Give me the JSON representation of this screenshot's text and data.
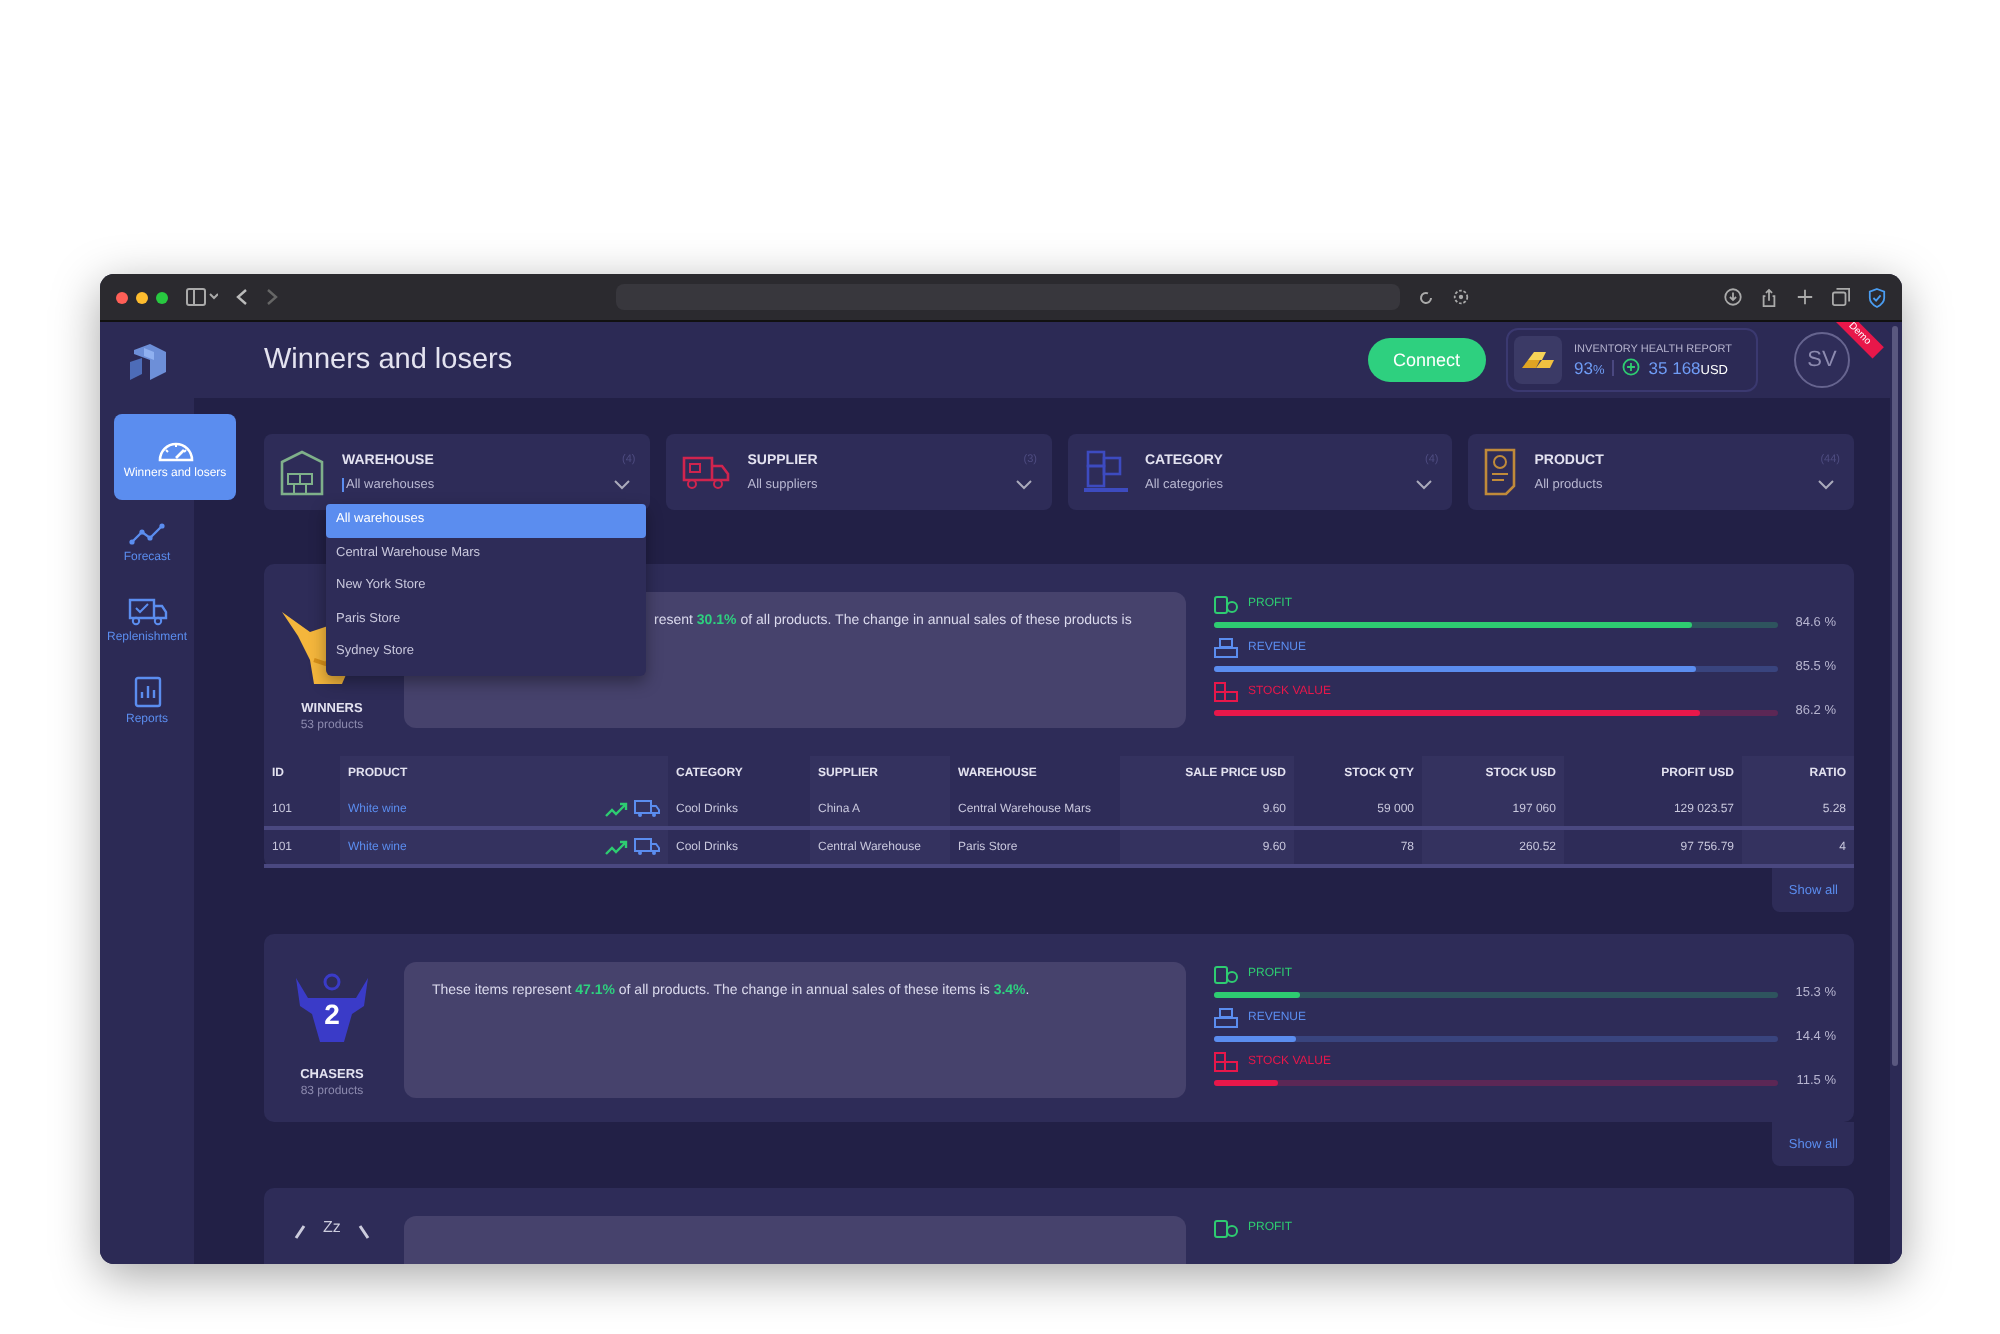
{
  "sidebar": {
    "items": [
      {
        "label": "Winners and losers",
        "selected": true
      },
      {
        "label": "Forecast",
        "selected": false
      },
      {
        "label": "Replenishment",
        "selected": false
      },
      {
        "label": "Reports",
        "selected": false
      }
    ]
  },
  "header": {
    "title": "Winners and losers",
    "connect_button": "Connect",
    "inventory": {
      "title": "INVENTORY HEALTH REPORT",
      "percent": "93",
      "percent_unit": "%",
      "amount": "35 168",
      "currency": "USD"
    },
    "avatar": {
      "initials": "SV",
      "ribbon": "Demo"
    }
  },
  "filters": [
    {
      "label": "WAREHOUSE",
      "count": "(4)",
      "value": "All warehouses",
      "open": true,
      "options": [
        {
          "label": "All warehouses",
          "selected": true
        },
        {
          "label": "Central Warehouse Mars",
          "selected": false
        },
        {
          "label": "New York Store",
          "selected": false
        },
        {
          "label": "Paris Store",
          "selected": false
        },
        {
          "label": "Sydney Store",
          "selected": false
        }
      ]
    },
    {
      "label": "SUPPLIER",
      "count": "(3)",
      "value": "All suppliers",
      "open": false
    },
    {
      "label": "CATEGORY",
      "count": "(4)",
      "value": "All categories",
      "open": false
    },
    {
      "label": "PRODUCT",
      "count": "(44)",
      "value": "All products",
      "open": false
    }
  ],
  "sections": [
    {
      "kind": "winner",
      "title": "WINNERS",
      "subtitle": "53 products",
      "summary": "resent **30.1%** of all products. The change in annual sales of these products is",
      "metrics": [
        {
          "label": "PROFIT",
          "color": "#2ecc71",
          "level": 0.846,
          "reading": "84.6 %"
        },
        {
          "label": "REVENUE",
          "color": "#5b8def",
          "level": 0.855,
          "reading": "85.5 %"
        },
        {
          "label": "STOCK VALUE",
          "color": "#e8174a",
          "level": 0.862,
          "reading": "86.2 %"
        }
      ],
      "table": {
        "columns": [
          "ID",
          "PRODUCT",
          "CATEGORY",
          "SUPPLIER",
          "WAREHOUSE",
          "SALE PRICE USD",
          "STOCK QTY",
          "STOCK USD",
          "PROFIT USD",
          "RATIO"
        ],
        "rows": [
          [
            "101",
            "White wine",
            "Cool Drinks",
            "China A",
            "Central Warehouse Mars",
            "9.60",
            "59 000",
            "197 060",
            "129 023.57",
            "5.28"
          ],
          [
            "101",
            "White wine",
            "Cool Drinks",
            "Central Warehouse",
            "Paris Store",
            "9.60",
            "78",
            "260.52",
            "97 756.79",
            "4"
          ]
        ]
      },
      "show_all": "Show all"
    },
    {
      "kind": "chaser",
      "badge_text": "2",
      "title": "CHASERS",
      "subtitle": "83 products",
      "summary": "These items represent **47.1%** of all products. The change in annual sales of these items is **3.4%**.",
      "metrics": [
        {
          "label": "PROFIT",
          "color": "#2ecc71",
          "level": 0.153,
          "reading": "15.3 %"
        },
        {
          "label": "REVENUE",
          "color": "#5b8def",
          "level": 0.144,
          "reading": "14.4 %"
        },
        {
          "label": "STOCK VALUE",
          "color": "#e8174a",
          "level": 0.115,
          "reading": "11.5 %"
        }
      ],
      "show_all": "Show all"
    },
    {
      "kind": "sleeper",
      "badge_text": "Zz",
      "metrics": [
        {
          "label": "PROFIT",
          "color": "#2ecc71"
        }
      ]
    }
  ]
}
